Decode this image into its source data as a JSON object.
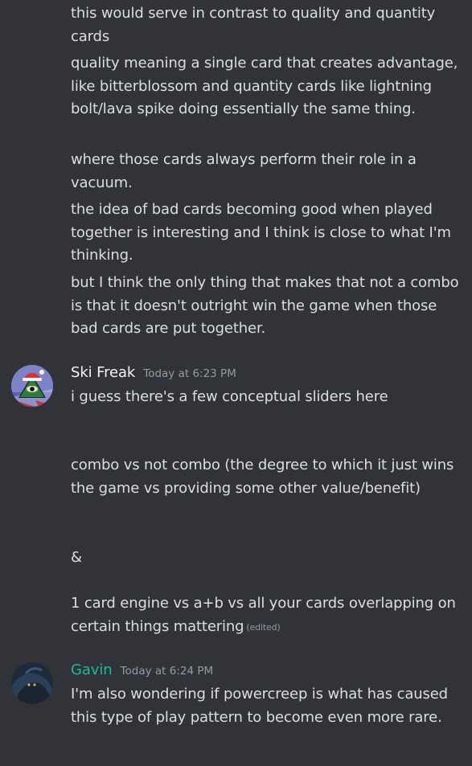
{
  "messages": {
    "continued": {
      "lines": [
        "this would serve in contrast to quality and quantity cards",
        "quality meaning a single card that creates advantage, like bitterblossom and quantity cards like lightning bolt/lava spike doing essentially the same thing.",
        "where those cards always perform their role in a vacuum.",
        "the idea of bad cards becoming good when played together is interesting and I think is close to what I'm thinking.",
        "but I think the only thing that makes that not a combo is that it doesn't outright win the game when those bad cards are put together."
      ]
    },
    "ski_freak": {
      "author": "Ski Freak",
      "timestamp": "Today at 6:23 PM",
      "avatar_icon": "illuminati-santa-avatar",
      "lines": [
        "i guess there's a few conceptual sliders here",
        "combo vs not combo (the degree to which it just wins the game vs providing some other value/benefit)",
        "&",
        "1 card engine vs a+b vs all your cards overlapping on certain things mattering"
      ],
      "edited_label": "(edited)"
    },
    "gavin": {
      "author": "Gavin",
      "author_color": "#1abc9c",
      "timestamp": "Today at 6:24 PM",
      "avatar_icon": "dark-creature-avatar",
      "lines": [
        "I'm also wondering if powercreep is what has caused this type of play pattern to become even more rare."
      ]
    }
  },
  "colors": {
    "background": "#313338",
    "text": "#dbdee1",
    "muted": "#949ba4",
    "username": "#f2f3f5"
  }
}
